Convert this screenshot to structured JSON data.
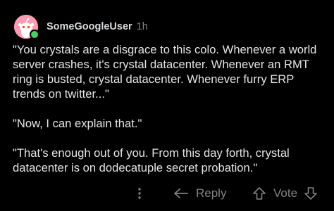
{
  "comment": {
    "username": "SomeGoogleUser",
    "time": "1h",
    "paragraphs": [
      "\"You crystals are a disgrace to this colo.  Whenever a world server crashes, it's crystal datacenter.  Whenever an RMT ring is busted, crystal datacenter.  Whenever furry ERP trends on twitter...\"",
      "\"Now, I can explain that.\"",
      "\"That's enough out of you.  From this day forth, crystal datacenter is on dodecatuple secret probation.\""
    ]
  },
  "actions": {
    "more_icon": "vertical-ellipsis-icon",
    "reply_label": "Reply",
    "reply_icon": "reply-arrow-icon",
    "vote_label": "Vote",
    "upvote_icon": "upvote-arrow-icon",
    "downvote_icon": "downvote-arrow-icon"
  },
  "colors": {
    "background": "#000000",
    "text": "#e3e5e6",
    "muted": "#818384",
    "avatar": "#ff9ab0",
    "online": "#46d160"
  }
}
